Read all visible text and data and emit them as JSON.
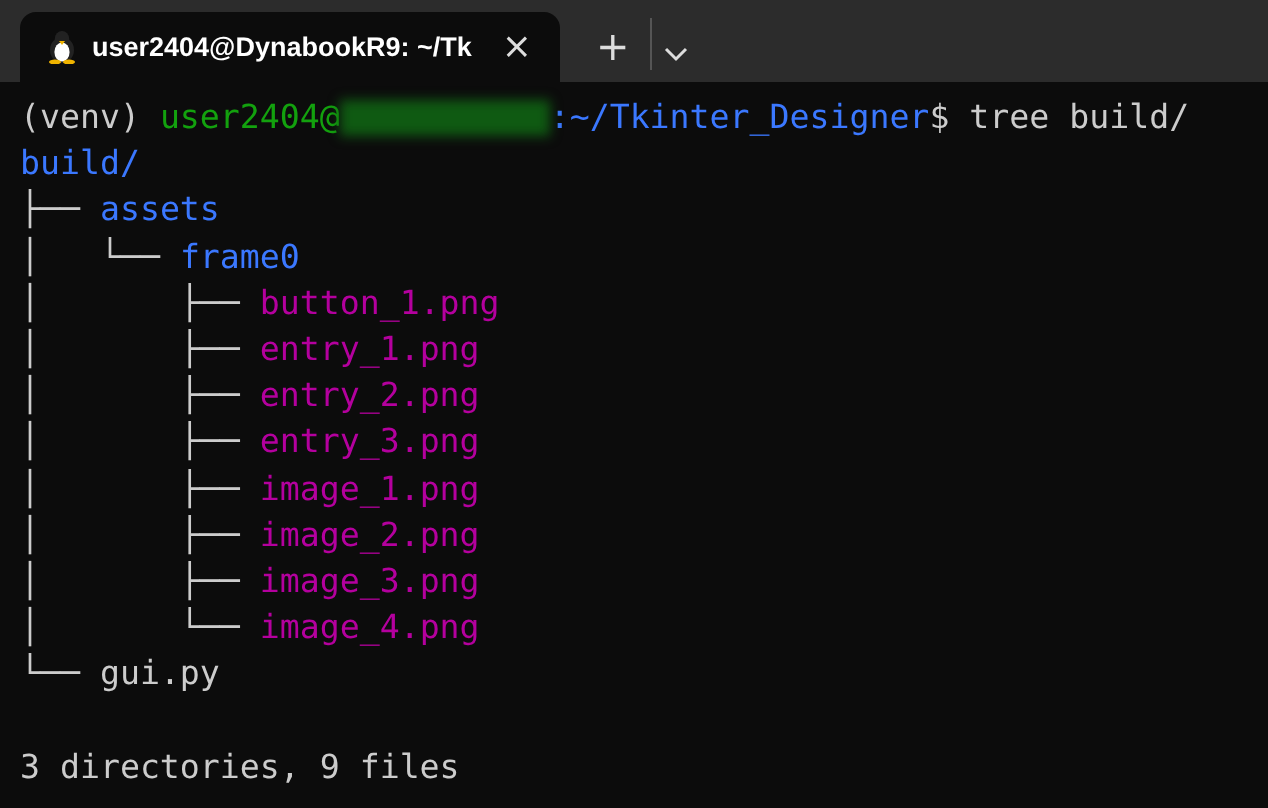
{
  "tab": {
    "title": "user2404@DynabookR9: ~/Tk",
    "close": "×",
    "selected": true
  },
  "new_tab": "+",
  "lines": [
    {
      "kind": "prompt",
      "segments": [
        {
          "kind": "plain",
          "text": "(venv) "
        },
        {
          "kind": "user",
          "text": "user2404@"
        },
        {
          "kind": "redacted"
        },
        {
          "kind": "path",
          "text": ":~/Tkinter_Designer"
        },
        {
          "kind": "plain",
          "text": "$ tree build/"
        }
      ]
    },
    {
      "kind": "output",
      "segments": [
        {
          "kind": "dir",
          "text": "build/"
        }
      ]
    },
    {
      "kind": "output",
      "segments": [
        {
          "kind": "tree",
          "text": "├── "
        },
        {
          "kind": "dir",
          "text": "assets"
        }
      ]
    },
    {
      "kind": "output",
      "segments": [
        {
          "kind": "tree",
          "text": "│   └── "
        },
        {
          "kind": "dir",
          "text": "frame0"
        }
      ]
    },
    {
      "kind": "output",
      "segments": [
        {
          "kind": "tree",
          "text": "│       ├── "
        },
        {
          "kind": "file",
          "text": "button_1.png"
        }
      ]
    },
    {
      "kind": "output",
      "segments": [
        {
          "kind": "tree",
          "text": "│       ├── "
        },
        {
          "kind": "file",
          "text": "entry_1.png"
        }
      ]
    },
    {
      "kind": "output",
      "segments": [
        {
          "kind": "tree",
          "text": "│       ├── "
        },
        {
          "kind": "file",
          "text": "entry_2.png"
        }
      ]
    },
    {
      "kind": "output",
      "segments": [
        {
          "kind": "tree",
          "text": "│       ├── "
        },
        {
          "kind": "file",
          "text": "entry_3.png"
        }
      ]
    },
    {
      "kind": "output",
      "segments": [
        {
          "kind": "tree",
          "text": "│       ├── "
        },
        {
          "kind": "file",
          "text": "image_1.png"
        }
      ]
    },
    {
      "kind": "output",
      "segments": [
        {
          "kind": "tree",
          "text": "│       ├── "
        },
        {
          "kind": "file",
          "text": "image_2.png"
        }
      ]
    },
    {
      "kind": "output",
      "segments": [
        {
          "kind": "tree",
          "text": "│       ├── "
        },
        {
          "kind": "file",
          "text": "image_3.png"
        }
      ]
    },
    {
      "kind": "output",
      "segments": [
        {
          "kind": "tree",
          "text": "│       └── "
        },
        {
          "kind": "file",
          "text": "image_4.png"
        }
      ]
    },
    {
      "kind": "output",
      "segments": [
        {
          "kind": "tree",
          "text": "└── "
        },
        {
          "kind": "plain",
          "text": "gui.py"
        }
      ]
    },
    {
      "kind": "summary",
      "segments": [
        {
          "kind": "plain",
          "text": "3 directories, 9 files"
        }
      ]
    }
  ]
}
